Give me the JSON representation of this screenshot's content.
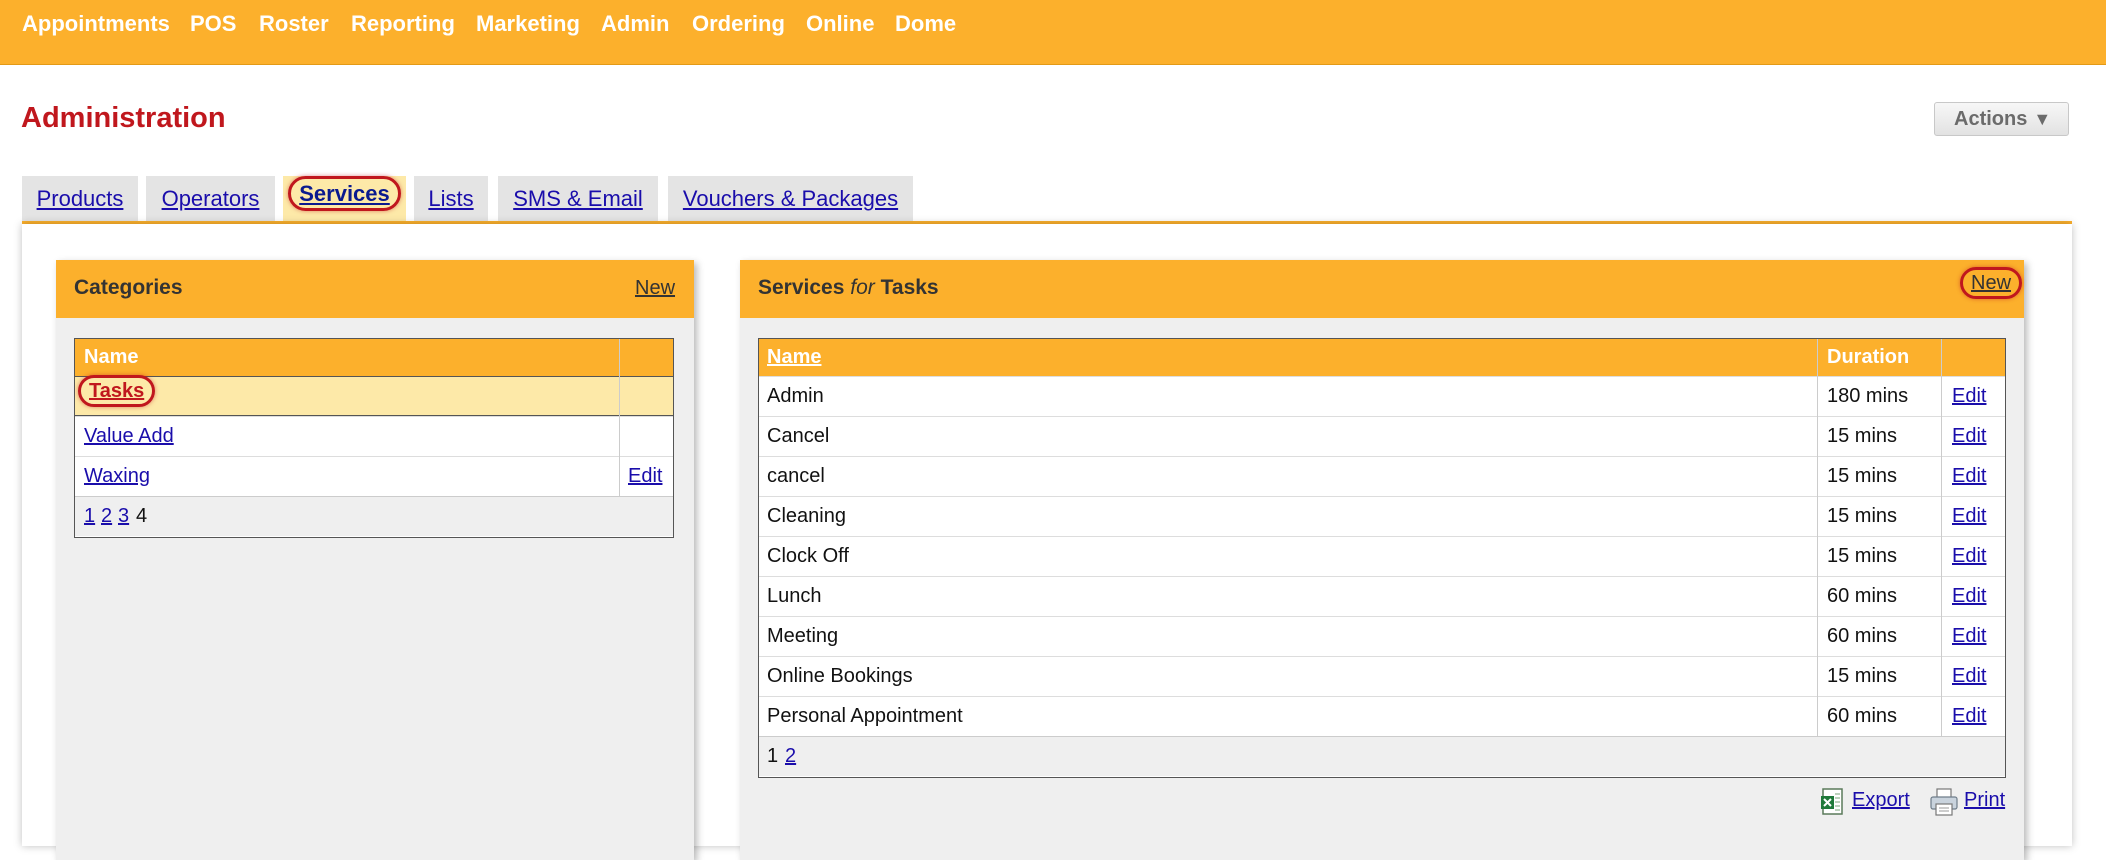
{
  "topnav": {
    "items": [
      "Appointments",
      "POS",
      "Roster",
      "Reporting",
      "Marketing",
      "Admin",
      "Ordering",
      "Online",
      "Dome"
    ]
  },
  "page": {
    "title": "Administration",
    "actions_label": "Actions",
    "actions_arrow": "▼"
  },
  "tabs": [
    "Products",
    "Operators",
    "Services",
    "Lists",
    "SMS & Email",
    "Vouchers & Packages"
  ],
  "categories": {
    "title": "Categories",
    "new_label": "New",
    "column_name": "Name",
    "rows": [
      {
        "name": "Tasks",
        "action": ""
      },
      {
        "name": "Value Add",
        "action": ""
      },
      {
        "name": "Waxing",
        "action": "Edit"
      }
    ],
    "pages": [
      "1",
      "2",
      "3",
      "4"
    ]
  },
  "services": {
    "title_prefix": "Services",
    "title_for": "for",
    "title_category": "Tasks",
    "new_label": "New",
    "column_name": "Name",
    "column_duration": "Duration",
    "edit_label": "Edit",
    "rows": [
      {
        "name": "Admin",
        "duration": "180 mins"
      },
      {
        "name": "Cancel",
        "duration": "15 mins"
      },
      {
        "name": "cancel",
        "duration": "15 mins"
      },
      {
        "name": "Cleaning",
        "duration": "15 mins"
      },
      {
        "name": "Clock Off",
        "duration": "15 mins"
      },
      {
        "name": "Lunch",
        "duration": "60 mins"
      },
      {
        "name": "Meeting",
        "duration": "60 mins"
      },
      {
        "name": "Online Bookings",
        "duration": "15 mins"
      },
      {
        "name": "Personal Appointment",
        "duration": "60 mins"
      }
    ],
    "pages": [
      "1",
      "2"
    ],
    "export_label": "Export",
    "print_label": "Print"
  },
  "colors": {
    "brand_orange": "#fcb02c",
    "title_red": "#c0171d",
    "selected_row": "#fde9a8",
    "link_blue": "#1a0dab"
  },
  "icons": [
    "excel-export-icon",
    "printer-icon",
    "dropdown-arrow-icon"
  ]
}
